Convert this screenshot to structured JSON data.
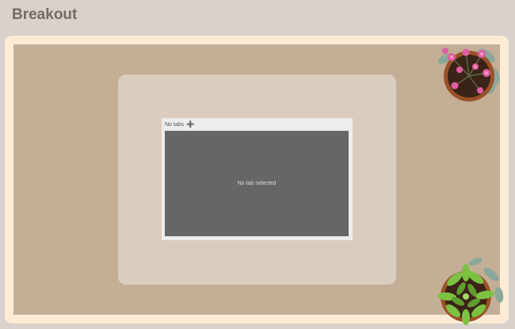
{
  "page": {
    "title": "Breakout"
  },
  "screen": {
    "tabs_label": "No tabs",
    "add_tab_icon": "plus-icon",
    "empty_message": "No tab selected"
  },
  "decor": {
    "top_plant": "pink-flower-plant-icon",
    "bottom_plant": "green-succulent-plant-icon"
  },
  "colors": {
    "background": "#d9d1cc",
    "room_frame": "#fdebd6",
    "floor": "#c4ae96",
    "table": "#dacdc0",
    "screen_content": "#666666"
  }
}
